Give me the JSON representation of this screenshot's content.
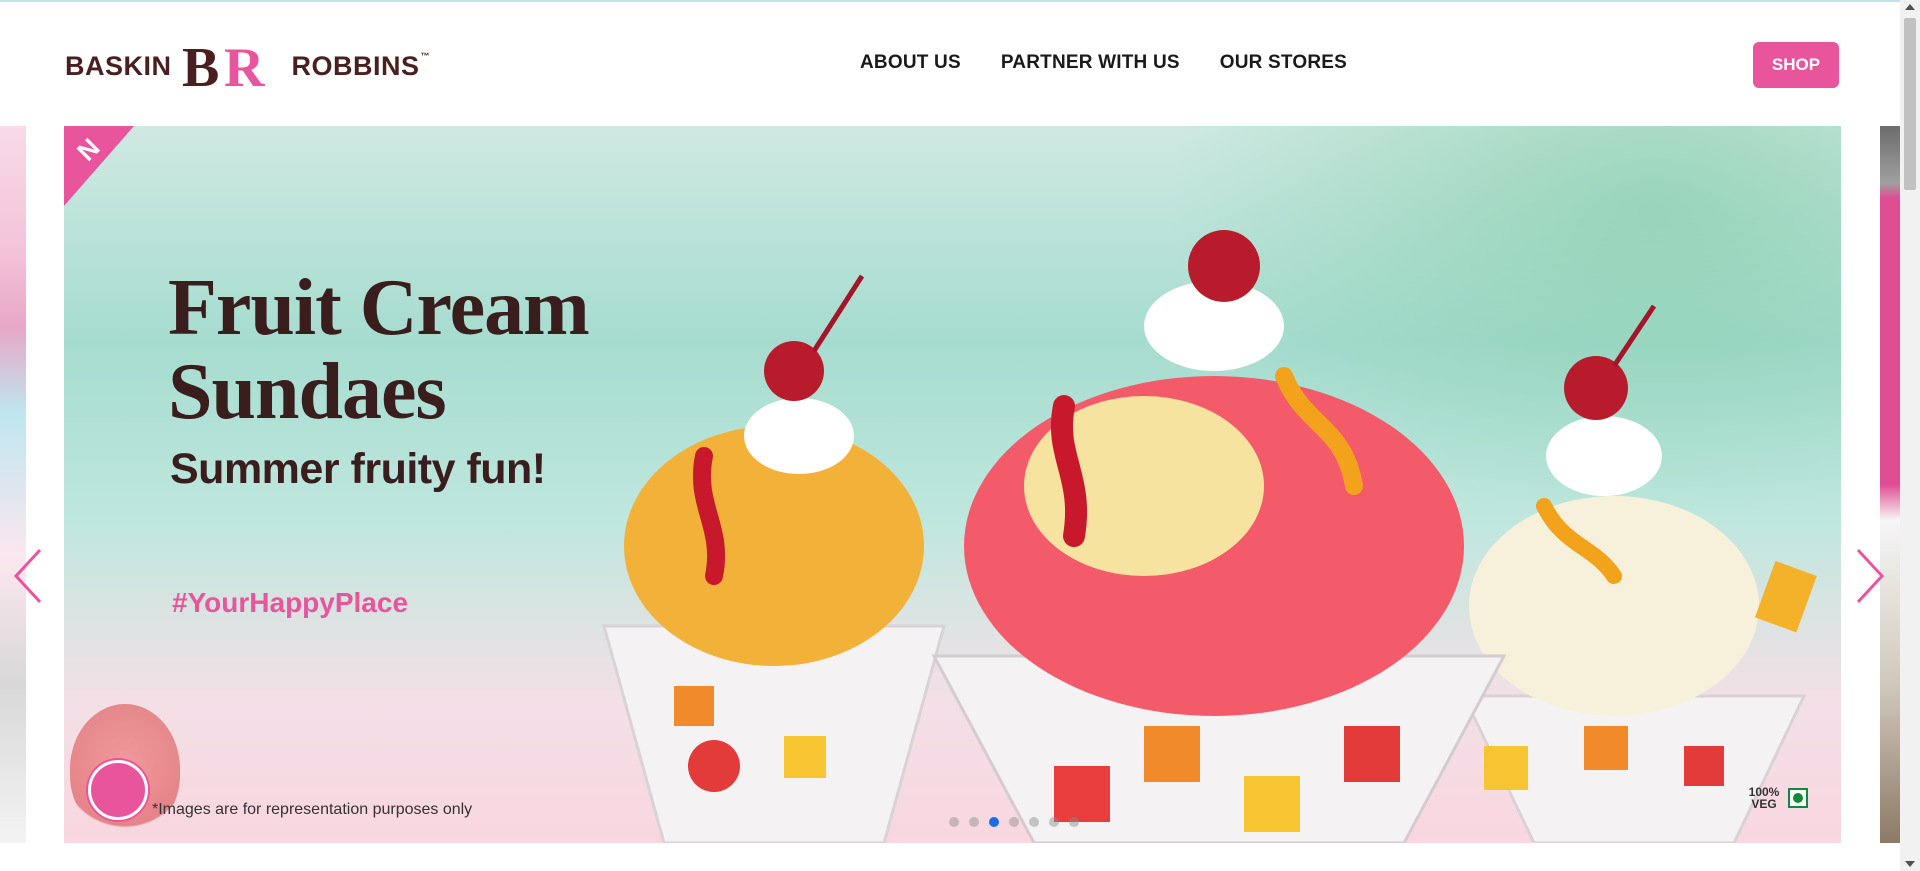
{
  "brand": {
    "word_left": "BASKIN",
    "word_right": "ROBBINS",
    "mark_letters": "BR",
    "trademark": "™"
  },
  "nav": {
    "items": [
      "ABOUT US",
      "PARTNER WITH US",
      "OUR STORES"
    ]
  },
  "shop": {
    "label": "SHOP"
  },
  "hero": {
    "headline": "Fruit Cream Sundaes",
    "subtitle": "Summer fruity fun!",
    "hashtag": "#YourHappyPlace",
    "disclaimer": "*Images are for representation purposes only",
    "veg_label": "100% VEG",
    "ribbon_text": "N"
  },
  "carousel": {
    "slide_count": 7,
    "active_index": 2
  },
  "colors": {
    "brand_pink": "#e8559c",
    "brand_brown": "#4a1f1f",
    "active_dot": "#1a6fe0",
    "veg_green": "#0d8a3a"
  },
  "icons": [
    "chevron-left-icon",
    "chevron-right-icon",
    "veg-symbol-icon",
    "cow-badge-icon",
    "br-logo-mark-icon"
  ]
}
